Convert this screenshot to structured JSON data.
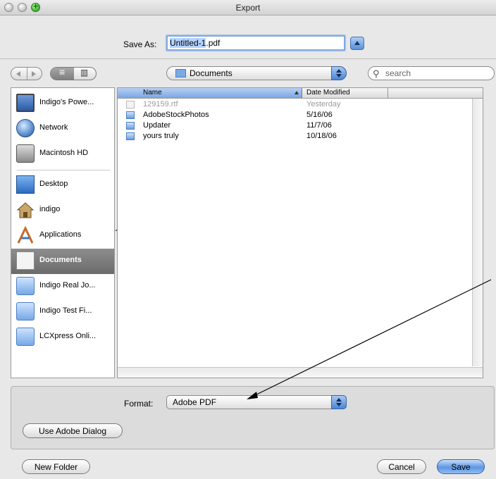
{
  "window": {
    "title": "Export"
  },
  "save_as": {
    "label": "Save As:",
    "value_selected": "Untitled-1",
    "value_ext": ".pdf"
  },
  "toolbar": {
    "location": "Documents",
    "search_placeholder": "search"
  },
  "sidebar": {
    "devices": [
      {
        "label": "Indigo's Powe...",
        "icon": "computer-icon"
      },
      {
        "label": "Network",
        "icon": "globe-icon"
      },
      {
        "label": "Macintosh HD",
        "icon": "hard-drive-icon"
      }
    ],
    "places": [
      {
        "label": "Desktop",
        "icon": "desktop-icon"
      },
      {
        "label": "indigo",
        "icon": "home-icon"
      },
      {
        "label": "Applications",
        "icon": "applications-icon"
      },
      {
        "label": "Documents",
        "icon": "documents-icon",
        "selected": true
      },
      {
        "label": "Indigo Real Jo...",
        "icon": "folder-icon"
      },
      {
        "label": "Indigo Test Fi...",
        "icon": "folder-icon"
      },
      {
        "label": "LCXpress Onli...",
        "icon": "folder-icon"
      }
    ]
  },
  "file_list": {
    "columns": {
      "name": "Name",
      "date": "Date Modified"
    },
    "rows": [
      {
        "name": "129159.rtf",
        "date": "Yesterday",
        "kind": "file",
        "dimmed": true
      },
      {
        "name": "AdobeStockPhotos",
        "date": "5/16/06",
        "kind": "folder"
      },
      {
        "name": "Updater",
        "date": "11/7/06",
        "kind": "folder"
      },
      {
        "name": "yours truly",
        "date": "10/18/06",
        "kind": "folder"
      }
    ]
  },
  "format": {
    "label": "Format:",
    "value": "Adobe PDF"
  },
  "buttons": {
    "use_adobe_dialog": "Use Adobe Dialog",
    "new_folder": "New Folder",
    "cancel": "Cancel",
    "save": "Save"
  }
}
